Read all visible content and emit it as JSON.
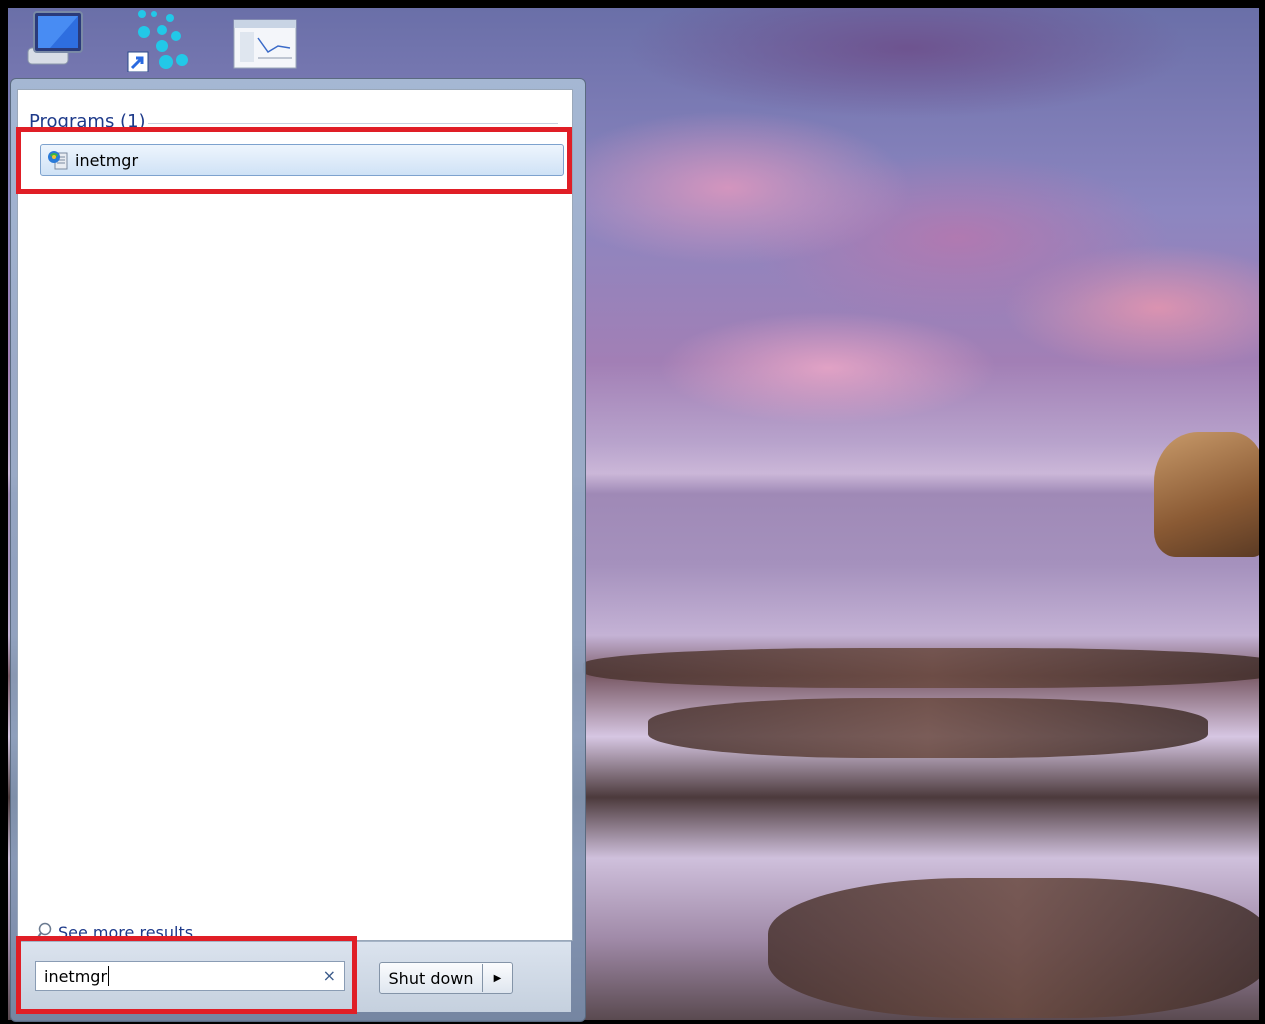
{
  "desktop": {
    "icons": [
      {
        "name": "computer-icon"
      },
      {
        "name": "dots-app-shortcut-icon"
      },
      {
        "name": "window-screenshot-icon"
      }
    ]
  },
  "start_menu": {
    "section_title": "Programs (1)",
    "program_item": {
      "label": "inetmgr",
      "icon": "iis-manager-icon"
    },
    "see_more_label": "See more results",
    "search": {
      "value": "inetmgr",
      "clear_glyph": "×"
    },
    "shutdown_label": "Shut down",
    "shutdown_arrow": "▶"
  },
  "annotations": {
    "highlight_color": "#e01e26"
  }
}
